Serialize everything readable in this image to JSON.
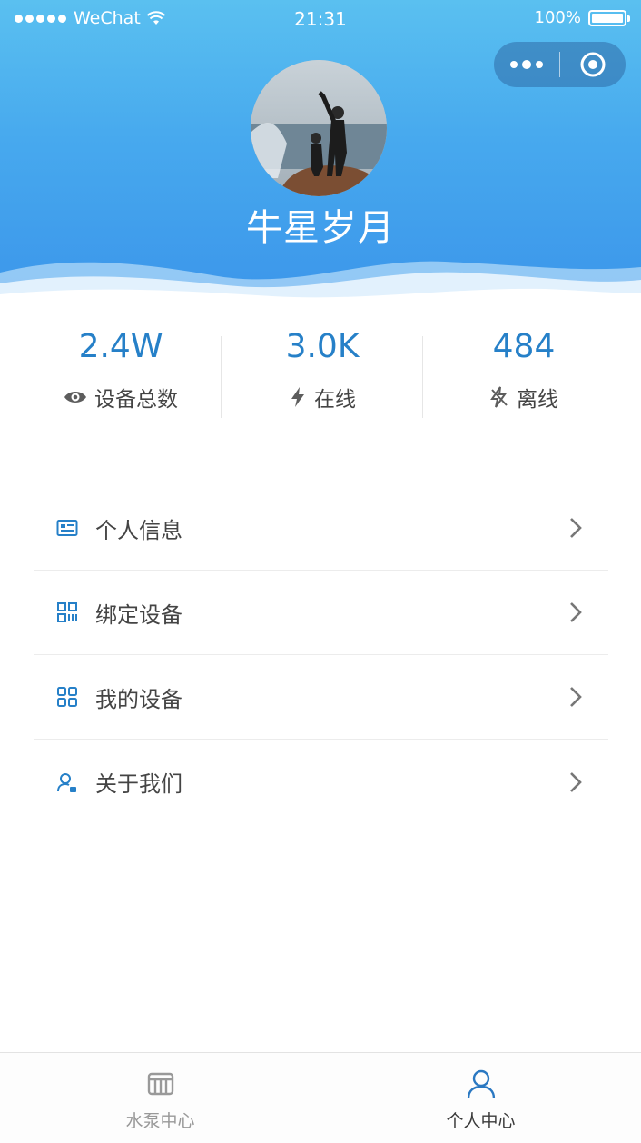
{
  "status_bar": {
    "carrier": "WeChat",
    "time": "21:31",
    "battery": "100%"
  },
  "profile": {
    "nickname": "牛星岁月"
  },
  "stats": [
    {
      "value": "2.4W",
      "label": "设备总数",
      "icon": "eye-icon"
    },
    {
      "value": "3.0K",
      "label": "在线",
      "icon": "bolt-icon"
    },
    {
      "value": "484",
      "label": "离线",
      "icon": "bolt-off-icon"
    }
  ],
  "menu": [
    {
      "label": "个人信息",
      "icon": "id-card-icon"
    },
    {
      "label": "绑定设备",
      "icon": "qr-code-icon"
    },
    {
      "label": "我的设备",
      "icon": "grid-icon"
    },
    {
      "label": "关于我们",
      "icon": "user-info-icon"
    }
  ],
  "tabbar": [
    {
      "label": "水泵中心",
      "icon": "pump-icon",
      "active": false
    },
    {
      "label": "个人中心",
      "icon": "person-icon",
      "active": true
    }
  ],
  "colors": {
    "accent": "#2680c8",
    "header_top": "#5ac0f0",
    "header_bottom": "#3b95ea"
  }
}
